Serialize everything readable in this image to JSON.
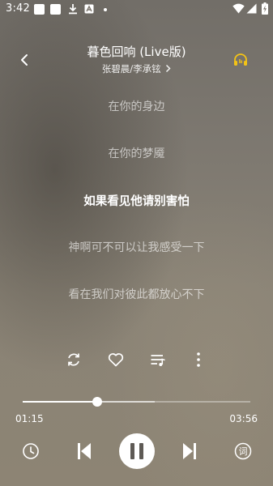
{
  "status_bar": {
    "time": "3:42"
  },
  "header": {
    "title": "暮色回响 (Live版)",
    "artist": "张碧晨/李承铉"
  },
  "lyrics": [
    {
      "text": "在你的身边",
      "current": false
    },
    {
      "text": "在你的梦魇",
      "current": false
    },
    {
      "text": "如果看见他请别害怕",
      "current": true
    },
    {
      "text": "神啊可不可以让我感受一下",
      "current": false
    },
    {
      "text": "看在我们对彼此都放心不下",
      "current": false
    }
  ],
  "actions": {
    "repeat_icon": "repeat-icon",
    "like_icon": "heart-icon",
    "playlist_icon": "playlist-icon",
    "more_icon": "more-vertical-icon"
  },
  "progress": {
    "elapsed": "01:15",
    "duration": "03:56",
    "played_fraction": 0.327,
    "buffered_fraction": 0.58
  },
  "controls": {
    "timer_icon": "clock-icon",
    "prev_icon": "skip-previous-icon",
    "pause_icon": "pause-icon",
    "next_icon": "skip-next-icon",
    "lyrics_label": "词"
  },
  "colors": {
    "accent": "#ffffff",
    "headphone_icon": "#f3c316"
  }
}
